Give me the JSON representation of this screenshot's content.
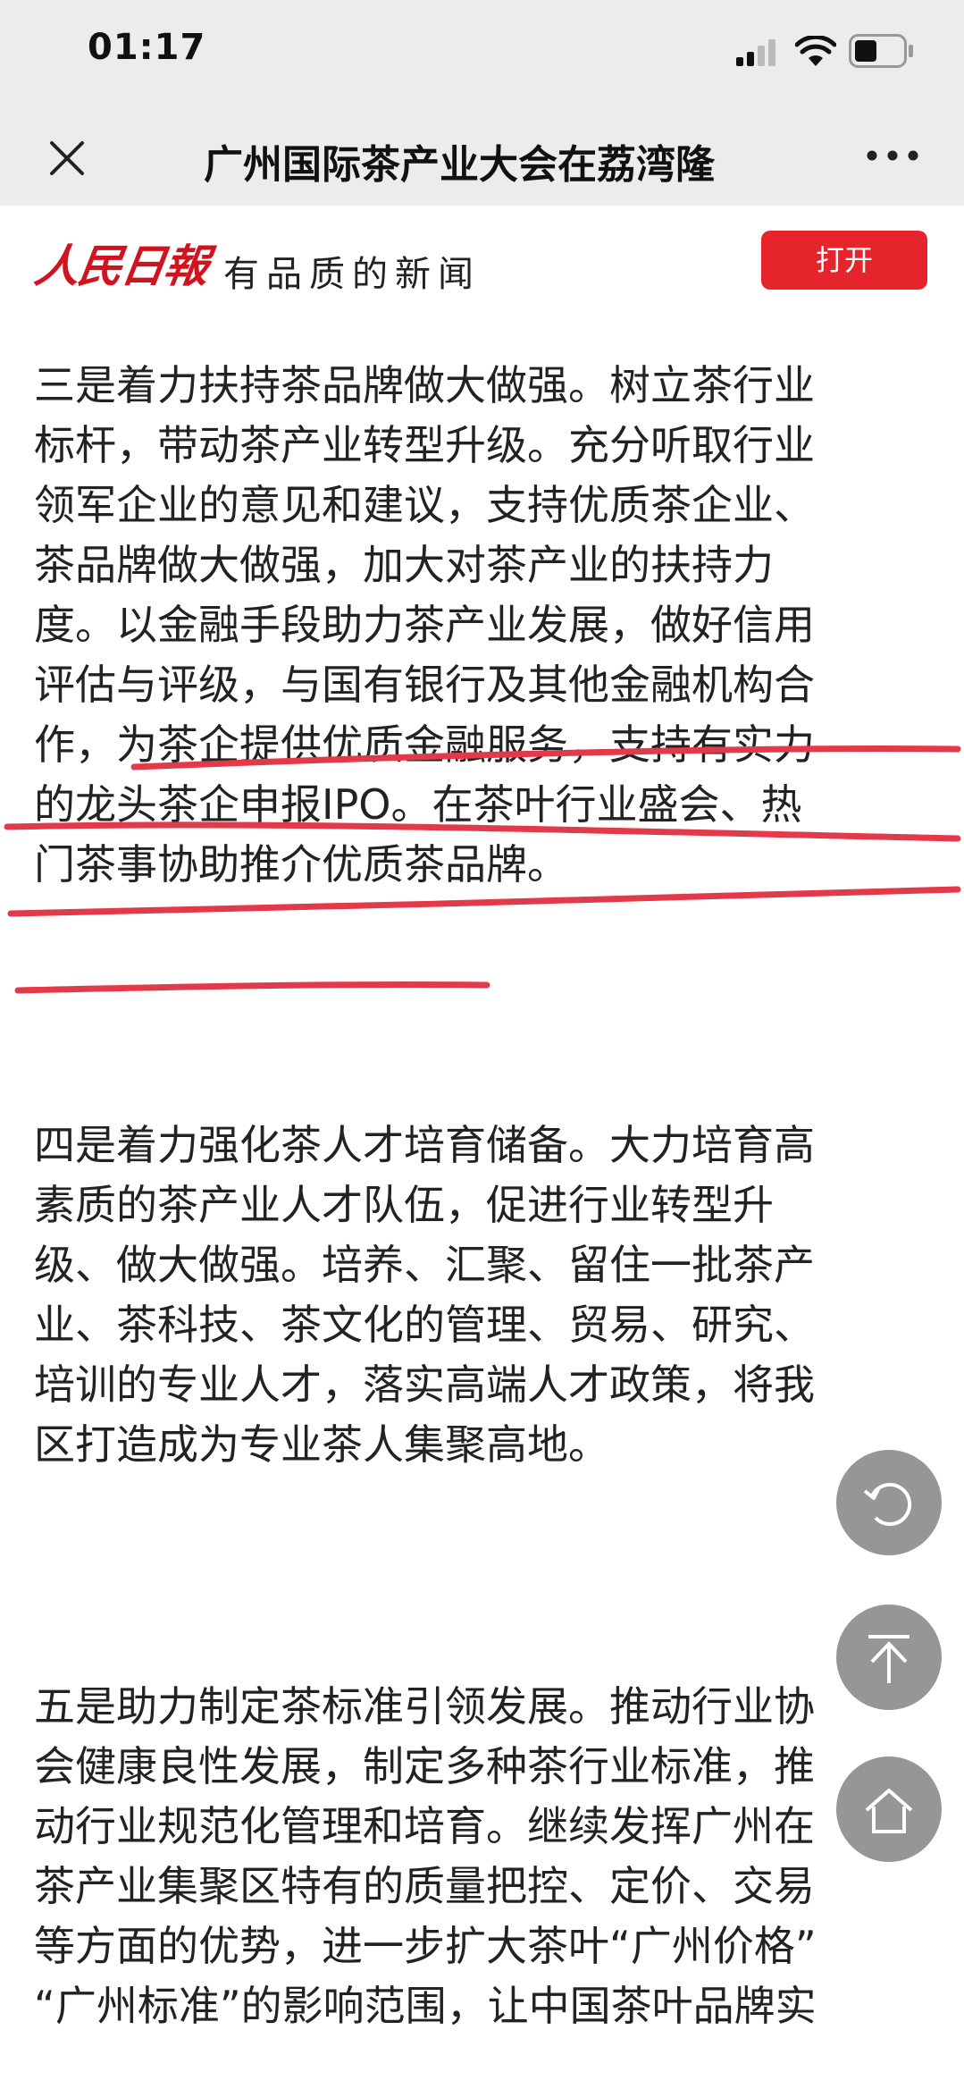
{
  "status_bar": {
    "time": "01:17",
    "signal_icon": "cellular-signal-icon",
    "wifi_icon": "wifi-icon",
    "battery_icon": "battery-icon"
  },
  "nav_bar": {
    "close_icon": "close-icon",
    "title": "广州国际茶产业大会在荔湾隆",
    "more_icon": "more-dots-icon"
  },
  "header": {
    "logo_text": "人民日報",
    "tagline": "有品质的新闻",
    "open_button_label": "打开",
    "accent_color": "#e5252b"
  },
  "article": {
    "paragraphs": [
      {
        "lines": [
          "三是着力扶持茶品牌做大做强。树立茶行业",
          "标杆，带动茶产业转型升级。充分听取行业",
          "领军企业的意见和建议，支持优质茶企业、",
          "茶品牌做大做强，加大对茶产业的扶持力",
          "度。以金融手段助力茶产业发展，做好信用",
          "评估与评级，与国有银行及其他金融机构合",
          "作，为茶企提供优质金融服务，支持有实力",
          "的龙头茶企申报IPO。在茶叶行业盛会、热",
          "门茶事协助推介优质茶品牌。"
        ]
      },
      {
        "lines": [
          "四是着力强化茶人才培育储备。大力培育高",
          "素质的茶产业人才队伍，促进行业转型升",
          "级、做大做强。培养、汇聚、留住一批茶产",
          "业、茶科技、茶文化的管理、贸易、研究、",
          "培训的专业人才，落实高端人才政策，将我",
          "区打造成为专业茶人集聚高地。"
        ]
      },
      {
        "lines": [
          "五是助力制定茶标准引领发展。推动行业协",
          "会健康良性发展，制定多种茶行业标准，推",
          "动行业规范化管理和培育。继续发挥广州在",
          "茶产业集聚区特有的质量把控、定价、交易",
          "等方面的优势，进一步扩大茶叶“广州价格”",
          "“广州标准”的影响范围，让中国茶叶品牌实"
        ]
      }
    ],
    "highlight_color": "#e23a4a"
  },
  "floating_buttons": {
    "refresh_icon": "refresh-icon",
    "scroll_top_icon": "arrow-up-icon",
    "home_icon": "home-icon"
  }
}
